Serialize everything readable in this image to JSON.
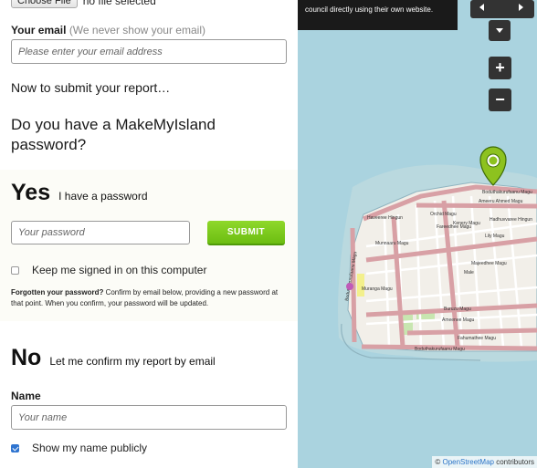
{
  "file": {
    "button_label": "Choose File",
    "status": "no file selected"
  },
  "email": {
    "label": "Your email",
    "hint": "(We never show your email)",
    "placeholder": "Please enter your email address"
  },
  "submit_intro": "Now to submit your report…",
  "password_question": "Do you have a MakeMyIsland password?",
  "yes_option": {
    "title": "Yes",
    "subtitle": "I have a password",
    "password_placeholder": "Your password",
    "submit_label": "SUBMIT",
    "keep_signed_in": "Keep me signed in on this computer",
    "forgot_title": "Forgotten your password?",
    "forgot_text": "Confirm by email below, providing a new password at that point. When you confirm, your password will be updated."
  },
  "no_option": {
    "title": "No",
    "subtitle": "Let me confirm my report by email"
  },
  "name": {
    "label": "Name",
    "placeholder": "Your name",
    "show_publicly": "Show my name publicly",
    "show_publicly_checked": true
  },
  "map": {
    "note": "council directly using their own website.",
    "zoom_in": "+",
    "zoom_out": "−",
    "attribution_prefix": "©",
    "attribution_link": "OpenStreetMap",
    "attribution_suffix": "contributors",
    "streets": {
      "boduthakurufaanu_top": "Boduthakurufaanu Magu",
      "ameeru_ahmed": "Ameeru Ahmed Magu",
      "haveeree": "Haveeree Hingun",
      "orchid": "Orchid Magu",
      "fareedhee": "Fareedhee Magu",
      "kenery": "Kenery Magu",
      "hadhuvvaree": "Hadhuvvaree Hingun",
      "lily": "Lily Magu",
      "munnaaru": "Munnaaru Magu",
      "majeedhee": "Majeedhee Magu",
      "male": "Male",
      "boduthakurufaanu_left": "Boduthakurufaanu Magu",
      "muranga": "Muranga Magu",
      "buruzu": "Buruzu Magu",
      "ameenee": "Ameenee Magu",
      "fahumathee": "Fahumathee Magu",
      "boduthakurufaanu_bottom": "Boduthakurufaanu Magu"
    }
  },
  "colors": {
    "submit_green": "#7cc91c",
    "map_water": "#aad3df",
    "road_pink": "#d8a0a5",
    "marker_green": "#8dc21f",
    "checkbox_blue": "#2f74d0"
  }
}
